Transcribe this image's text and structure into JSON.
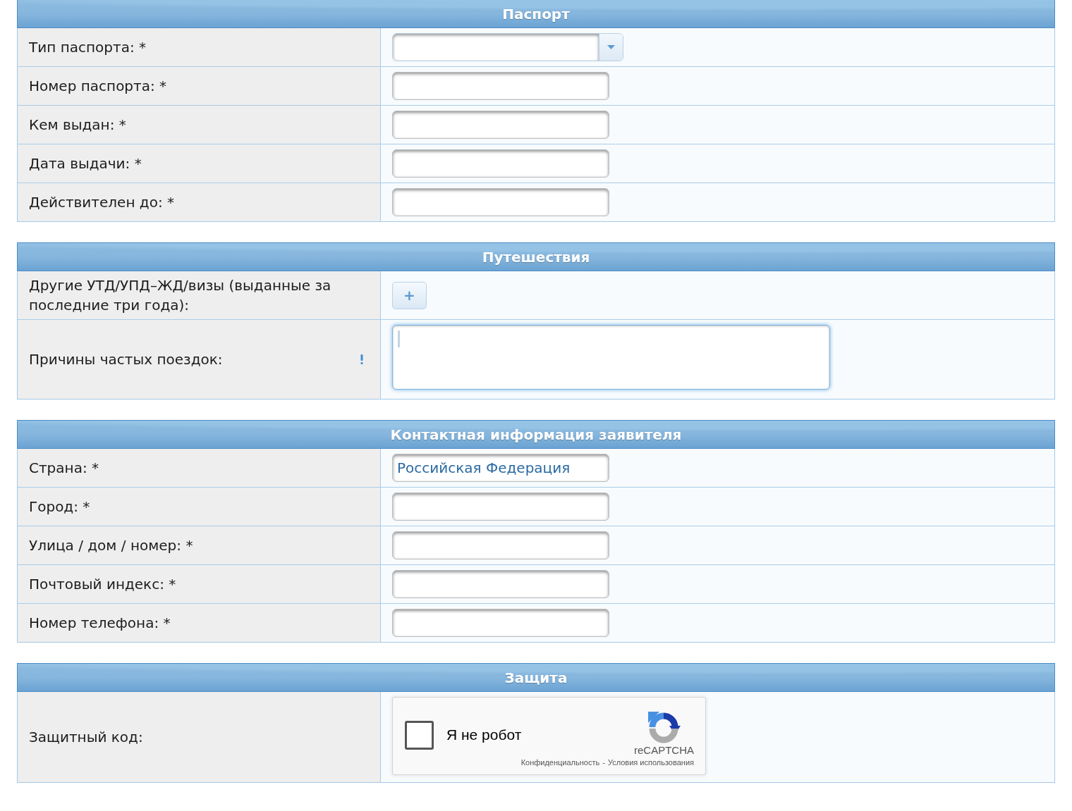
{
  "sections": [
    {
      "title": "Паспорт",
      "rows": [
        {
          "label": "Тип паспорта: *",
          "kind": "select",
          "hint": false
        },
        {
          "label": "Номер паспорта: *",
          "kind": "input",
          "hint": false
        },
        {
          "label": "Кем выдан: *",
          "kind": "input",
          "hint": false
        },
        {
          "label": "Дата выдачи: *",
          "kind": "input",
          "hint": false
        },
        {
          "label": "Действителен до: *",
          "kind": "input",
          "hint": false
        }
      ]
    },
    {
      "title": "Путешествия",
      "rows": [
        {
          "label": "Другие УТД/УПД–ЖД/визы (выданные за последние три года):",
          "kind": "add",
          "button": "+",
          "hint": false
        },
        {
          "label": "Причины частых поездок:",
          "kind": "textarea",
          "focused": true,
          "hint": true
        }
      ]
    },
    {
      "title": "Контактная информация заявителя",
      "rows": [
        {
          "label": "Страна: *",
          "kind": "input",
          "value": "Российская Федерация",
          "hint": false
        },
        {
          "label": "Город: *",
          "kind": "input",
          "hint": false
        },
        {
          "label": "Улица / дом / номер: *",
          "kind": "input",
          "hint": false
        },
        {
          "label": "Почтовый индекс: *",
          "kind": "input",
          "hint": false
        },
        {
          "label": "Номер телефона: *",
          "kind": "input",
          "hint": false
        }
      ]
    },
    {
      "title": "Защита",
      "rows": [
        {
          "label": "Защитный код:",
          "kind": "captcha",
          "hint": false,
          "captcha": {
            "checked": false,
            "label": "Я не робот",
            "brand": "reCAPTCHA",
            "links": [
              "Конфиденциальность",
              "Условия использования"
            ],
            "separator": "-"
          }
        }
      ]
    }
  ]
}
